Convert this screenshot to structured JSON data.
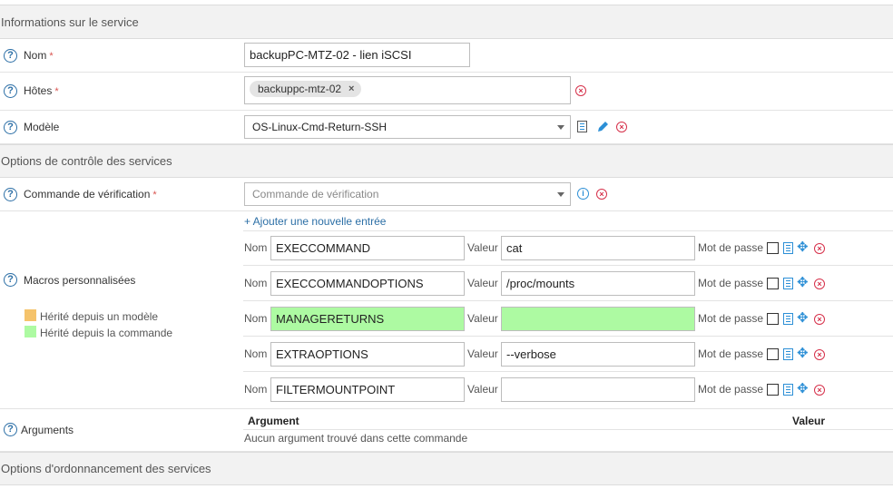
{
  "sections": {
    "service_info": "Informations sur le service",
    "check_options": "Options de contrôle des services",
    "scheduling": "Options d'ordonnancement des services"
  },
  "help_glyph": "?",
  "required_mark": "*",
  "fields": {
    "name": {
      "label": "Nom",
      "value": "backupPC-MTZ-02 - lien iSCSI"
    },
    "hosts": {
      "label": "Hôtes",
      "chip": "backuppc-mtz-02",
      "chip_remove": "×"
    },
    "template": {
      "label": "Modèle",
      "value": "OS-Linux-Cmd-Return-SSH"
    },
    "check_command": {
      "label": "Commande de vérification",
      "placeholder": "Commande de vérification"
    }
  },
  "macros": {
    "label": "Macros personnalisées",
    "add_link": "+ Ajouter une nouvelle entrée",
    "name_label": "Nom",
    "value_label": "Valeur",
    "password_label": "Mot de passe",
    "legend": {
      "template": "Hérité depuis un modèle",
      "command": "Hérité depuis la commande",
      "template_color": "#f5c36b",
      "command_color": "#adfaa2"
    },
    "rows": [
      {
        "name": "EXECCOMMAND",
        "value": "cat",
        "inherited": false
      },
      {
        "name": "EXECCOMMANDOPTIONS",
        "value": "/proc/mounts",
        "inherited": false
      },
      {
        "name": "MANAGERETURNS",
        "value": "",
        "inherited": true
      },
      {
        "name": "EXTRAOPTIONS",
        "value": "--verbose",
        "inherited": false
      },
      {
        "name": "FILTERMOUNTPOINT",
        "value": "",
        "inherited": false
      }
    ]
  },
  "arguments": {
    "label": "Arguments",
    "col_argument": "Argument",
    "col_value": "Valeur",
    "empty_text": "Aucun argument trouvé dans cette commande"
  },
  "icons": {
    "delete": "×",
    "info": "i",
    "move": "✥"
  }
}
